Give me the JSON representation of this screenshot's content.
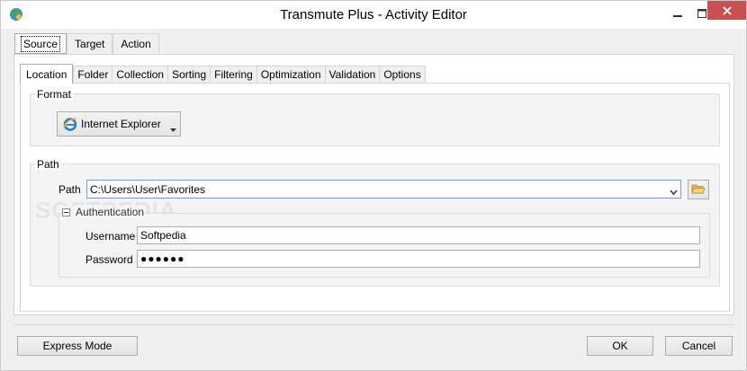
{
  "window": {
    "title": "Transmute Plus - Activity Editor"
  },
  "outer_tabs": [
    {
      "label": "Source",
      "active": true
    },
    {
      "label": "Target",
      "active": false
    },
    {
      "label": "Action",
      "active": false
    }
  ],
  "inner_tabs": [
    {
      "label": "Location",
      "active": true
    },
    {
      "label": "Folder",
      "active": false
    },
    {
      "label": "Collection",
      "active": false
    },
    {
      "label": "Sorting",
      "active": false
    },
    {
      "label": "Filtering",
      "active": false
    },
    {
      "label": "Optimization",
      "active": false
    },
    {
      "label": "Validation",
      "active": false
    },
    {
      "label": "Options",
      "active": false
    }
  ],
  "format": {
    "group_label": "Format",
    "selected": "Internet Explorer",
    "icon": "internet-explorer-icon"
  },
  "path": {
    "group_label": "Path",
    "field_label": "Path",
    "value": "C:\\Users\\User\\Favorites"
  },
  "authentication": {
    "label": "Authentication",
    "username_label": "Username",
    "username_value": "Softpedia",
    "password_label": "Password",
    "password_value": "●●●●●●"
  },
  "watermark": "SOFTPEDIA",
  "buttons": {
    "express": "Express Mode",
    "ok": "OK",
    "cancel": "Cancel"
  },
  "colors": {
    "close_button": "#c75050",
    "focus_border": "#7a9cd3"
  }
}
